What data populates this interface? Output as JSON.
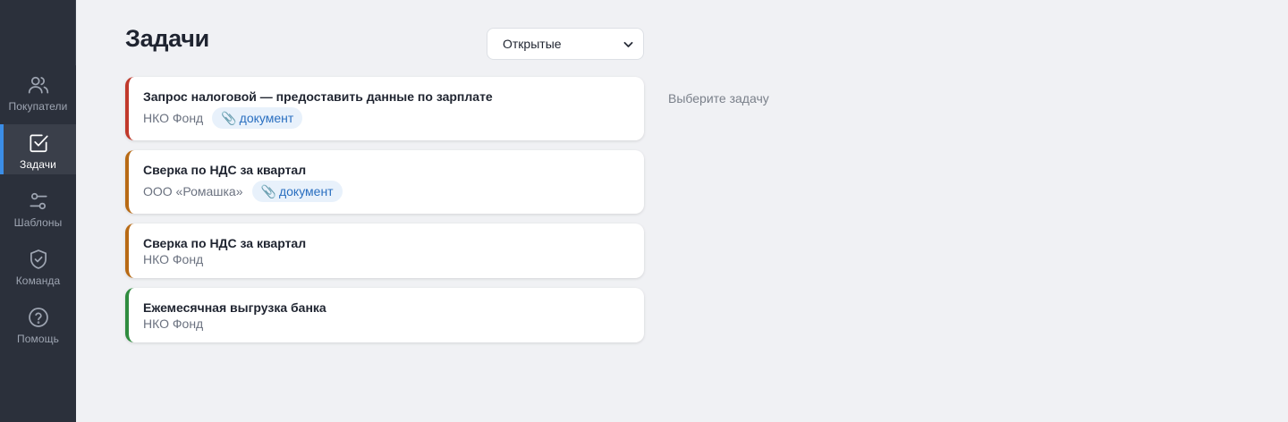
{
  "sidebar": {
    "items": [
      {
        "label": "Покупатели",
        "icon": "users-icon",
        "active": false
      },
      {
        "label": "Задачи",
        "icon": "check-square-icon",
        "active": true
      },
      {
        "label": "Шаблоны",
        "icon": "sliders-icon",
        "active": false
      },
      {
        "label": "Команда",
        "icon": "shield-check-icon",
        "active": false
      },
      {
        "label": "Помощь",
        "icon": "help-circle-icon",
        "active": false
      }
    ]
  },
  "header": {
    "title": "Задачи",
    "filter": {
      "selected": "Открытые"
    }
  },
  "tasks": [
    {
      "title": "Запрос налоговой — предоставить данные по зарплате",
      "client": "НКО Фонд",
      "badge": "документ",
      "color": "#c0392b"
    },
    {
      "title": "Сверка по НДС за квартал",
      "client": "ООО «Ромашка»",
      "badge": "документ",
      "color": "#b86a14"
    },
    {
      "title": "Сверка по НДС за квартал",
      "client": "НКО Фонд",
      "badge": null,
      "color": "#b86a14"
    },
    {
      "title": "Ежемесячная выгрузка банка",
      "client": "НКО Фонд",
      "badge": null,
      "color": "#2e8b3e"
    }
  ],
  "detail": {
    "empty_text": "Выберите задачу"
  },
  "colors": {
    "accent": "#3b8de6",
    "sidebar_bg": "#2b303b",
    "badge_bg": "#e8f1fb",
    "badge_text": "#2a6fc0"
  }
}
